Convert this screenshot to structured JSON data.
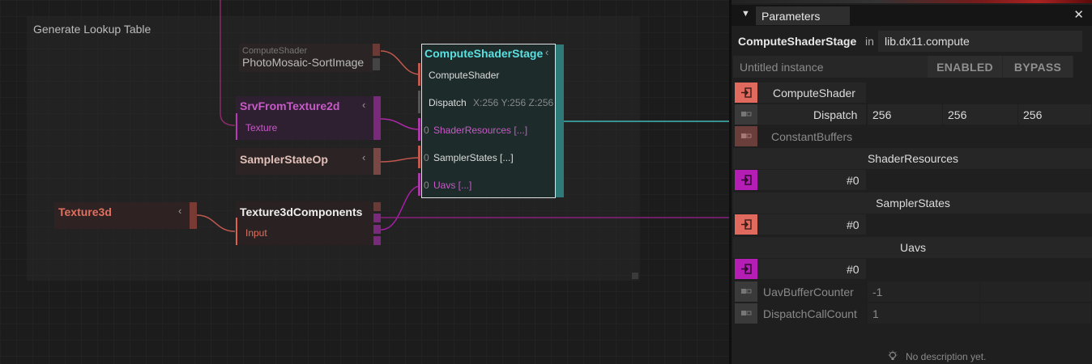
{
  "graph": {
    "annotation": {
      "title": "Generate Lookup Table"
    },
    "nodes": {
      "compute_shader": {
        "type_label": "ComputeShader",
        "name": "PhotoMosaic-SortImage"
      },
      "srv": {
        "title": "SrvFromTexture2d",
        "port": "Texture"
      },
      "sampler": {
        "title": "SamplerStateOp"
      },
      "texture3d": {
        "title": "Texture3d"
      },
      "tex3d_components": {
        "title": "Texture3dComponents",
        "port": "Input"
      },
      "stage": {
        "title": "ComputeShaderStage",
        "inputs": {
          "compute_shader": "ComputeShader",
          "dispatch": "Dispatch",
          "dispatch_value": "X:256 Y:256 Z:256",
          "shader_resources_count": "0",
          "shader_resources": "ShaderResources [...]",
          "sampler_states_count": "0",
          "sampler_states": "SamplerStates [...]",
          "uavs_count": "0",
          "uavs": "Uavs [...]"
        }
      }
    }
  },
  "parameters": {
    "tab_label": "Parameters",
    "operator_name": "ComputeShaderStage",
    "in_label": "in",
    "namespace": "lib.dx11.compute",
    "instance_name": "Untitled instance",
    "enabled_label": "ENABLED",
    "bypass_label": "BYPASS",
    "rows": {
      "compute_shader": "ComputeShader",
      "dispatch": "Dispatch",
      "dispatch_x": "256",
      "dispatch_y": "256",
      "dispatch_z": "256",
      "constant_buffers": "ConstantBuffers",
      "shader_resources_group": "ShaderResources",
      "shader_resources_item": "#0",
      "sampler_states_group": "SamplerStates",
      "sampler_states_item": "#0",
      "uavs_group": "Uavs",
      "uavs_item": "#0",
      "uav_buffer_counter": "UavBufferCounter",
      "uav_buffer_counter_value": "-1",
      "dispatch_call_count": "DispatchCallCount",
      "dispatch_call_count_value": "1"
    },
    "description": "No description yet."
  },
  "colors": {
    "shader": "#e06a5e",
    "texture": "#b41eb4",
    "stage": "#5ae0e0",
    "connection_cyan": "#3fb8b8"
  }
}
